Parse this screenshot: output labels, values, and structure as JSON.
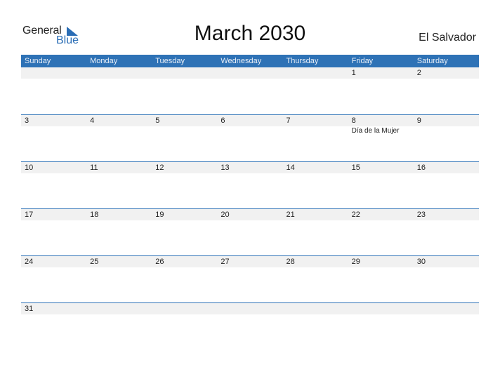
{
  "logo": {
    "general": "General",
    "blue": "Blue"
  },
  "title": "March 2030",
  "country": "El Salvador",
  "colors": {
    "accent": "#2e72b6",
    "strip": "#f1f1f1"
  },
  "days": [
    "Sunday",
    "Monday",
    "Tuesday",
    "Wednesday",
    "Thursday",
    "Friday",
    "Saturday"
  ],
  "weeks": [
    {
      "dates": [
        "",
        "",
        "",
        "",
        "",
        "1",
        "2"
      ],
      "events": [
        "",
        "",
        "",
        "",
        "",
        "",
        ""
      ]
    },
    {
      "dates": [
        "3",
        "4",
        "5",
        "6",
        "7",
        "8",
        "9"
      ],
      "events": [
        "",
        "",
        "",
        "",
        "",
        "Día de la Mujer",
        ""
      ]
    },
    {
      "dates": [
        "10",
        "11",
        "12",
        "13",
        "14",
        "15",
        "16"
      ],
      "events": [
        "",
        "",
        "",
        "",
        "",
        "",
        ""
      ]
    },
    {
      "dates": [
        "17",
        "18",
        "19",
        "20",
        "21",
        "22",
        "23"
      ],
      "events": [
        "",
        "",
        "",
        "",
        "",
        "",
        ""
      ]
    },
    {
      "dates": [
        "24",
        "25",
        "26",
        "27",
        "28",
        "29",
        "30"
      ],
      "events": [
        "",
        "",
        "",
        "",
        "",
        "",
        ""
      ]
    },
    {
      "dates": [
        "31",
        "",
        "",
        "",
        "",
        "",
        ""
      ],
      "events": [
        "",
        "",
        "",
        "",
        "",
        "",
        ""
      ]
    }
  ]
}
